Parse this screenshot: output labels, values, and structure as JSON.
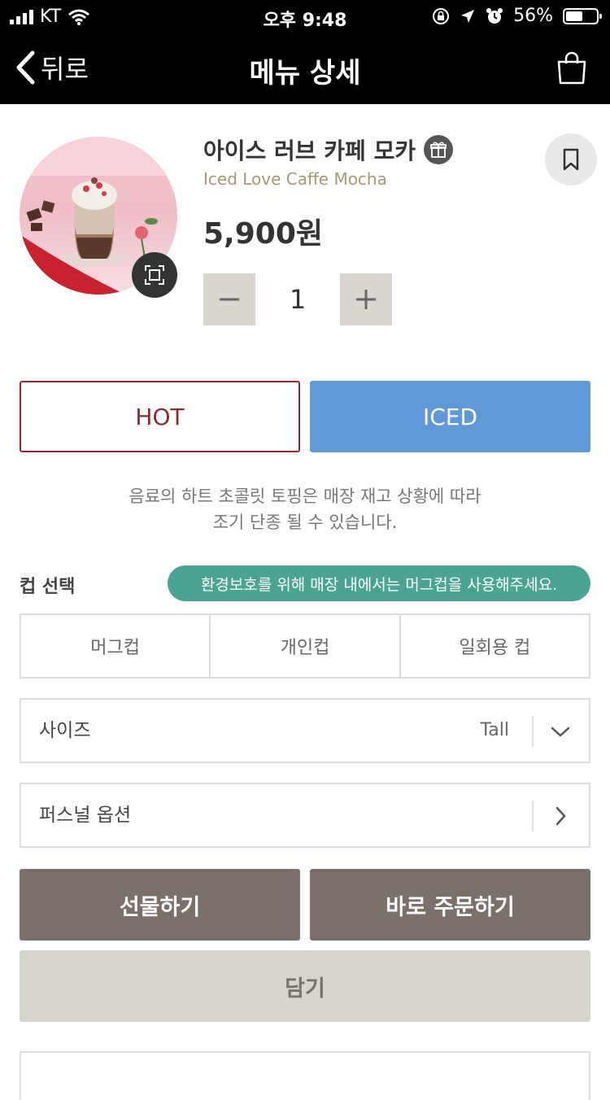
{
  "status_bar": {
    "carrier": "KT",
    "time": "오후 9:48",
    "battery": "56%",
    "battery_level": 0.56
  },
  "header": {
    "back_label": "뒤로",
    "title": "메뉴 상세"
  },
  "product": {
    "name_ko": "아이스 러브 카페 모카",
    "name_en": "Iced Love Caffe Mocha",
    "price": "5,900원",
    "quantity": "1"
  },
  "temperature": {
    "hot_label": "HOT",
    "iced_label": "ICED",
    "selected": "ICED"
  },
  "notice": {
    "line1": "음료의 하트 초콜릿 토핑은 매장 재고 상황에 따라",
    "line2": "조기 단종 될 수 있습니다."
  },
  "cup": {
    "label": "컵 선택",
    "eco_message": "환경보호를 위해 매장 내에서는 머그컵을 사용해주세요.",
    "options": [
      "머그컵",
      "개인컵",
      "일회용 컵"
    ]
  },
  "size": {
    "label": "사이즈",
    "value": "Tall"
  },
  "personal_option": {
    "label": "퍼스널 옵션"
  },
  "actions": {
    "gift": "선물하기",
    "order_now": "바로 주문하기",
    "add_cart": "담기"
  },
  "colors": {
    "hot_border": "#8a2a35",
    "iced_bg": "#6198d6",
    "eco_bg": "#4ba393",
    "action_dark": "#7a6f69",
    "action_light": "#d8d5cf"
  }
}
